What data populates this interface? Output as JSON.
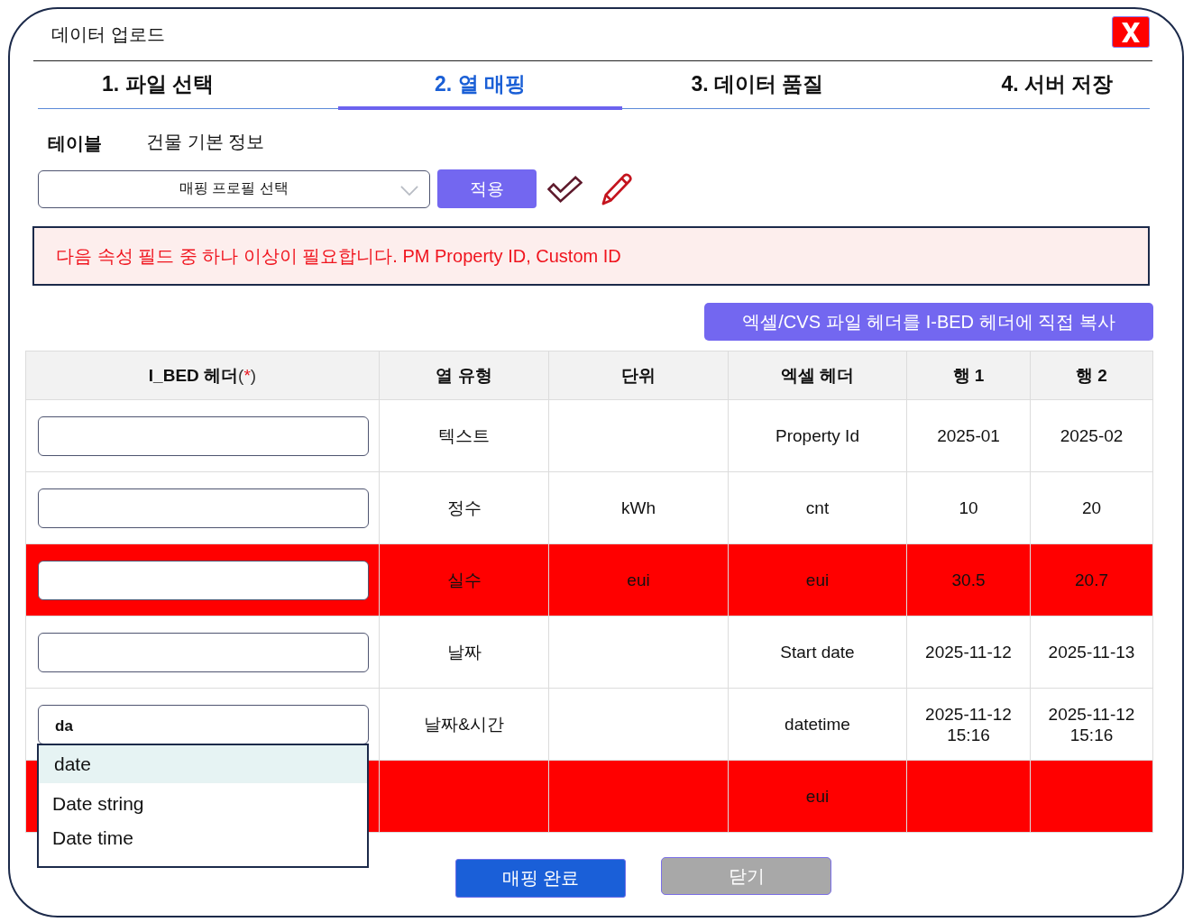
{
  "window": {
    "title": "데이터 업로드"
  },
  "tabs": [
    {
      "label": "1. 파일 선택",
      "selected": false
    },
    {
      "label": "2. 열 매핑",
      "selected": true
    },
    {
      "label": "3. 데이터 품질",
      "selected": false
    },
    {
      "label": "4. 서버 저장",
      "selected": false
    }
  ],
  "table_info": {
    "label": "테이블",
    "value": "건물 기본 정보"
  },
  "profile": {
    "placeholder": "매핑 프로필 선택",
    "apply_button": "적용"
  },
  "alert": {
    "message": "다음 속성 필드 중 하나 이상이 필요합니다. PM Property ID, Custom ID"
  },
  "copy_button": "엑셀/CVS 파일 헤더를 I-BED 헤더에 직접 복사",
  "mapping_table": {
    "columns": [
      {
        "label": "I_BED 헤더",
        "required_mark": "(*)"
      },
      {
        "label": "열 유형"
      },
      {
        "label": "단위"
      },
      {
        "label": "엑셀 헤더"
      },
      {
        "label": "행 1"
      },
      {
        "label": "행 2"
      }
    ],
    "rows": [
      {
        "error": false,
        "input_field": true,
        "column_type": "텍스트",
        "excel_header": "Property Id",
        "row_1": "2025-01",
        "row_2": "2025-02"
      },
      {
        "error": false,
        "input_field": true,
        "column_type": "정수",
        "unit": "kWh",
        "excel_header": "cnt",
        "row_1": "10",
        "row_2": "20"
      },
      {
        "error": true,
        "input_field": true,
        "column_type": "실수",
        "unit": "eui",
        "excel_header": "eui",
        "row_1": "30.5",
        "row_2": "20.7"
      },
      {
        "error": false,
        "input_field": true,
        "column_type": "날짜",
        "excel_header": "Start date",
        "row_1": "2025-11-12",
        "row_2": "2025-11-13"
      },
      {
        "error": false,
        "input_field": true,
        "input_value": "da",
        "suggestions": [
          {
            "label": "date",
            "selected": true
          },
          {
            "label": "Date string",
            "selected": false
          },
          {
            "label": "Date time",
            "selected": false
          }
        ],
        "column_type": "날짜&시간",
        "excel_header": "datetime",
        "row_1": "2025-11-12 15:16",
        "row_2": "2025-11-12 15:16"
      },
      {
        "error": true,
        "excel_header": "eui"
      }
    ]
  },
  "footer_buttons": [
    {
      "label": "매핑 완료",
      "kind": "primary"
    },
    {
      "label": "닫기",
      "kind": "secondary"
    }
  ]
}
